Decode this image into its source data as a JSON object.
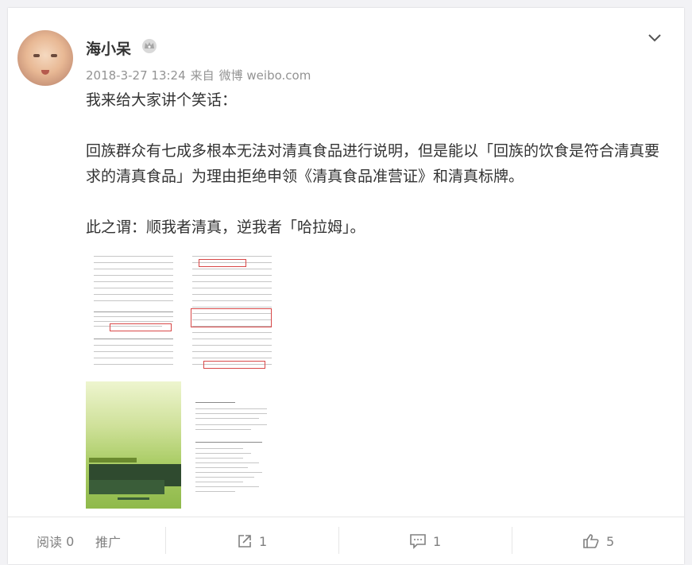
{
  "post": {
    "author": "海小呆",
    "timestamp": "2018-3-27 13:24",
    "source_prefix": "来自",
    "source": "微博 weibo.com",
    "paragraphs": [
      "我来给大家讲个笑话：",
      "回族群众有七成多根本无法对清真食品进行说明，但是能以「回族的饮食是符合清真要求的清真食品」为理由拒绝申领《清真食品准营证》和清真标牌。",
      "此之谓：顺我者清真，逆我者「哈拉姆」。"
    ]
  },
  "icons": {
    "vip": "crown-badge-icon",
    "menu": "chevron-down-icon",
    "share": "share-icon",
    "comment": "comment-icon",
    "like": "thumbs-up-icon"
  },
  "footer": {
    "read_label": "阅读",
    "read_count": "0",
    "promote_label": "推广",
    "share_count": "1",
    "comment_count": "1",
    "like_count": "5"
  },
  "colors": {
    "text": "#333333",
    "meta": "#939393",
    "highlight_box": "#d84848"
  }
}
